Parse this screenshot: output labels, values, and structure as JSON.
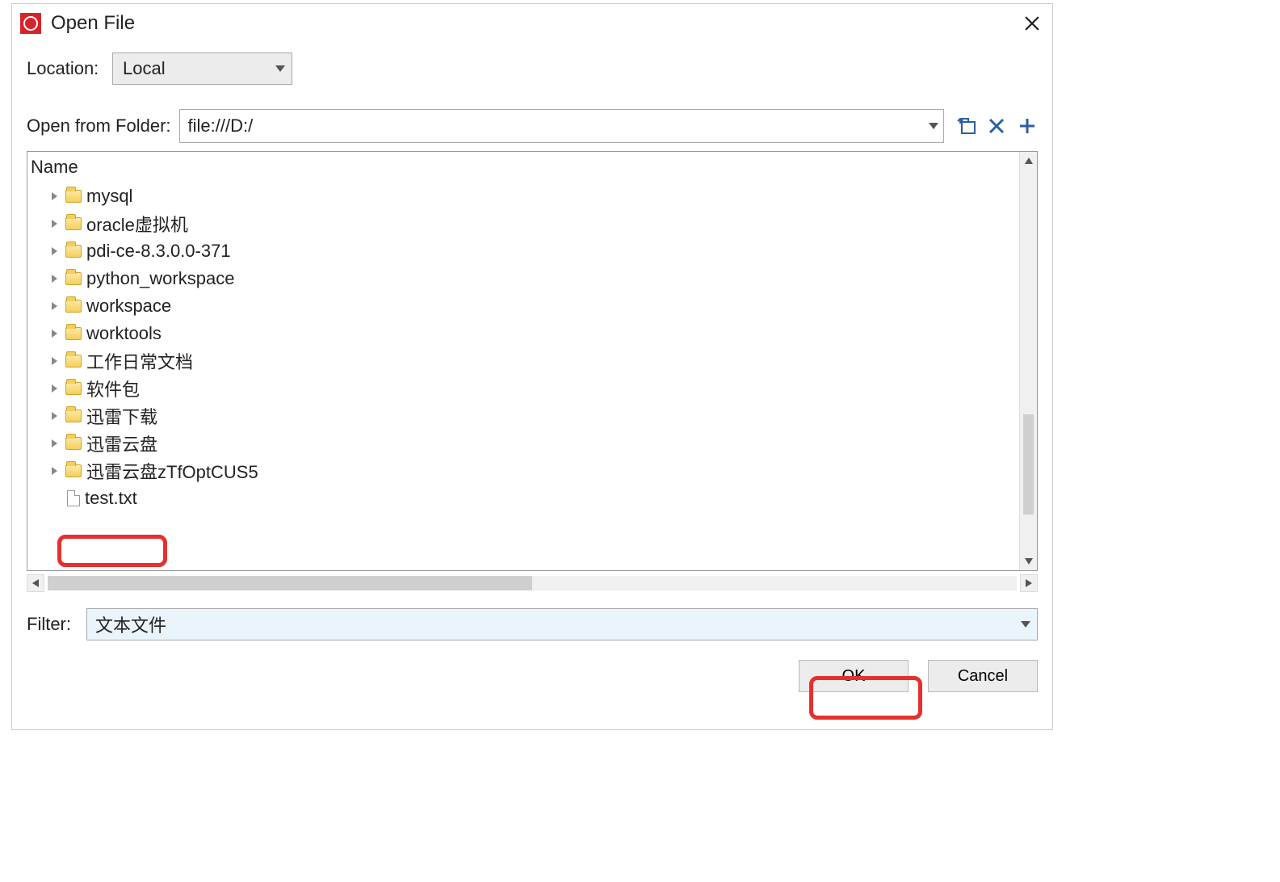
{
  "window": {
    "title": "Open File"
  },
  "location": {
    "label": "Location:",
    "value": "Local"
  },
  "folder": {
    "label": "Open from Folder:",
    "path": "file:///D:/"
  },
  "columns": {
    "name": "Name"
  },
  "files": [
    {
      "type": "folder",
      "name": "mysql"
    },
    {
      "type": "folder",
      "name": "oracle虚拟机"
    },
    {
      "type": "folder",
      "name": "pdi-ce-8.3.0.0-371"
    },
    {
      "type": "folder",
      "name": "python_workspace"
    },
    {
      "type": "folder",
      "name": "workspace"
    },
    {
      "type": "folder",
      "name": "worktools"
    },
    {
      "type": "folder",
      "name": "工作日常文档"
    },
    {
      "type": "folder",
      "name": "软件包"
    },
    {
      "type": "folder",
      "name": "迅雷下载"
    },
    {
      "type": "folder",
      "name": "迅雷云盘"
    },
    {
      "type": "folder",
      "name": "迅雷云盘zTfOptCUS5"
    },
    {
      "type": "file",
      "name": "test.txt"
    }
  ],
  "filter": {
    "label": "Filter:",
    "value": "文本文件"
  },
  "buttons": {
    "ok": "OK",
    "cancel": "Cancel"
  }
}
